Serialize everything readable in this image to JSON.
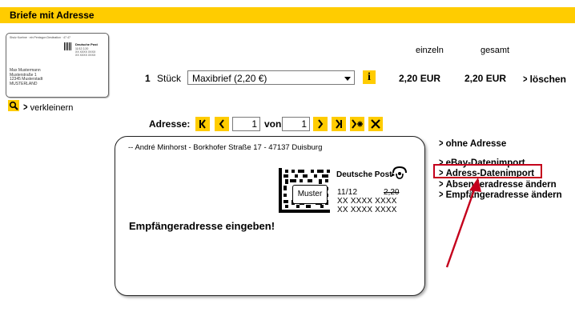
{
  "header": {
    "title": "Briefe mit Adresse"
  },
  "thumbnail": {
    "sender": "Shulz Kuehne · ein Pentagon Destination · 47 47",
    "brand": "Deutsche Post",
    "stamp_lines": [
      "11/12  2,20",
      "XX XXXX XXXX",
      "XX XXXX XXXX"
    ],
    "address_lines": [
      "Max Mustermann",
      "Musterstraße 1",
      "12345 Musterstadt",
      "MUSTERLAND"
    ]
  },
  "zoom": {
    "label": "verkleinern"
  },
  "columns": {
    "single": "einzeln",
    "total": "gesamt"
  },
  "order": {
    "quantity": "1",
    "unit": "Stück",
    "product": "Maxibrief (2,20 €)",
    "price_single": "2,20  EUR",
    "price_total": "2,20  EUR",
    "delete_label": "löschen",
    "info_label": "i"
  },
  "pager": {
    "label": "Adresse:",
    "current": "1",
    "of_label": "von",
    "total": "1"
  },
  "envelope": {
    "sender_line": "-- André Minhorst - Borkhofer Straße 17 - 47137 Duisburg",
    "brand": "Deutsche Post",
    "muster": "Muster",
    "stamp_date": "11/12",
    "stamp_price": "2,20",
    "stamp_code_1": "XX XXXX XXXX",
    "stamp_code_2": "XX XXXX XXXX",
    "recipient_prompt": "Empfängeradresse eingeben!"
  },
  "side_links": [
    "ohne Adresse",
    "eBay-Datenimport",
    "Adress-Datenimport",
    "Absenderadresse ändern",
    "Empfängeradresse ändern"
  ],
  "colors": {
    "accent": "#ffcc00",
    "highlight": "#c4001c"
  }
}
